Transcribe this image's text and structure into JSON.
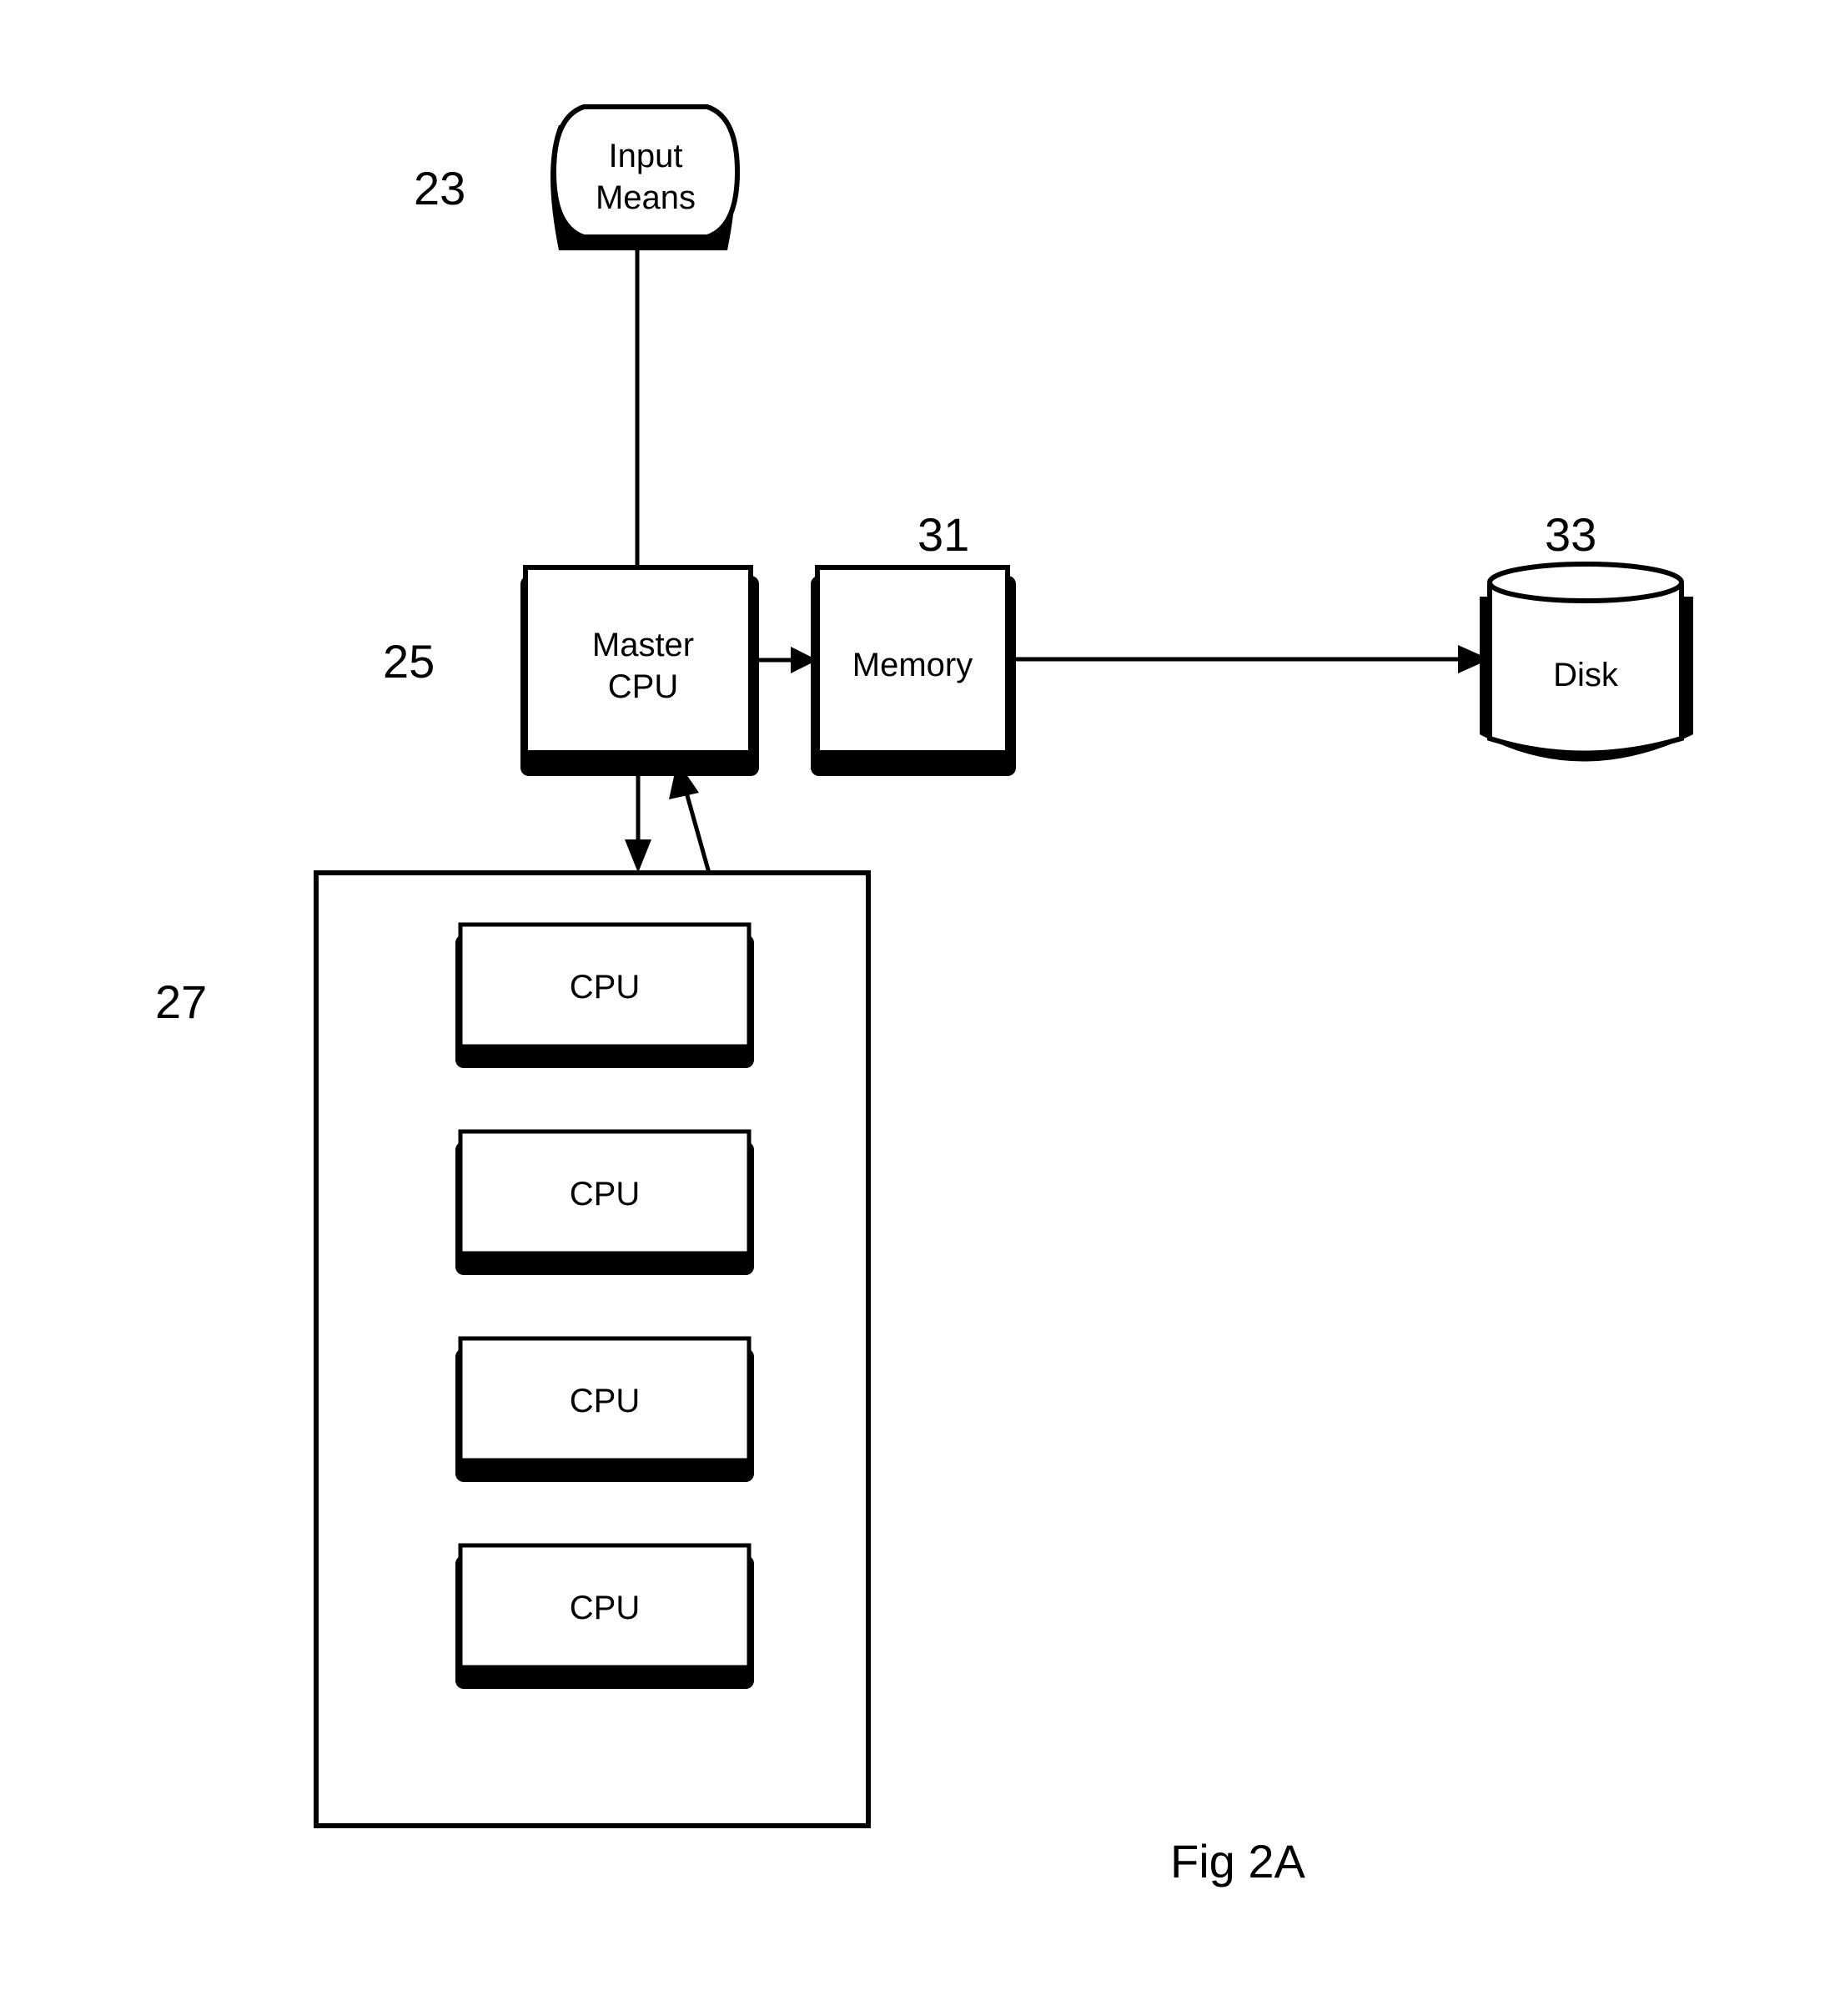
{
  "figure": {
    "title": "Fig 2A"
  },
  "nodes": {
    "input_means": {
      "ref": "23",
      "label_lines": [
        "Input",
        "Means"
      ]
    },
    "master_cpu": {
      "ref": "25",
      "label_lines": [
        "Master",
        "CPU"
      ]
    },
    "memory": {
      "ref": "31",
      "label": "Memory"
    },
    "disk": {
      "ref": "33",
      "label": "Disk"
    },
    "cpu_group": {
      "ref": "27",
      "cpus": [
        {
          "label": "CPU"
        },
        {
          "label": "CPU"
        },
        {
          "label": "CPU"
        },
        {
          "label": "CPU"
        }
      ]
    }
  },
  "edges": [
    {
      "from": "input_means",
      "to": "master_cpu",
      "style": "line"
    },
    {
      "from": "master_cpu",
      "to": "memory",
      "style": "arrow"
    },
    {
      "from": "memory",
      "to": "disk",
      "style": "arrow"
    },
    {
      "from": "master_cpu",
      "to": "cpu_group",
      "style": "arrow"
    },
    {
      "from": "cpu_group",
      "to": "master_cpu",
      "style": "arrow"
    }
  ],
  "colors": {
    "stroke": "#000000",
    "fill": "#ffffff",
    "shadow": "#000000"
  }
}
